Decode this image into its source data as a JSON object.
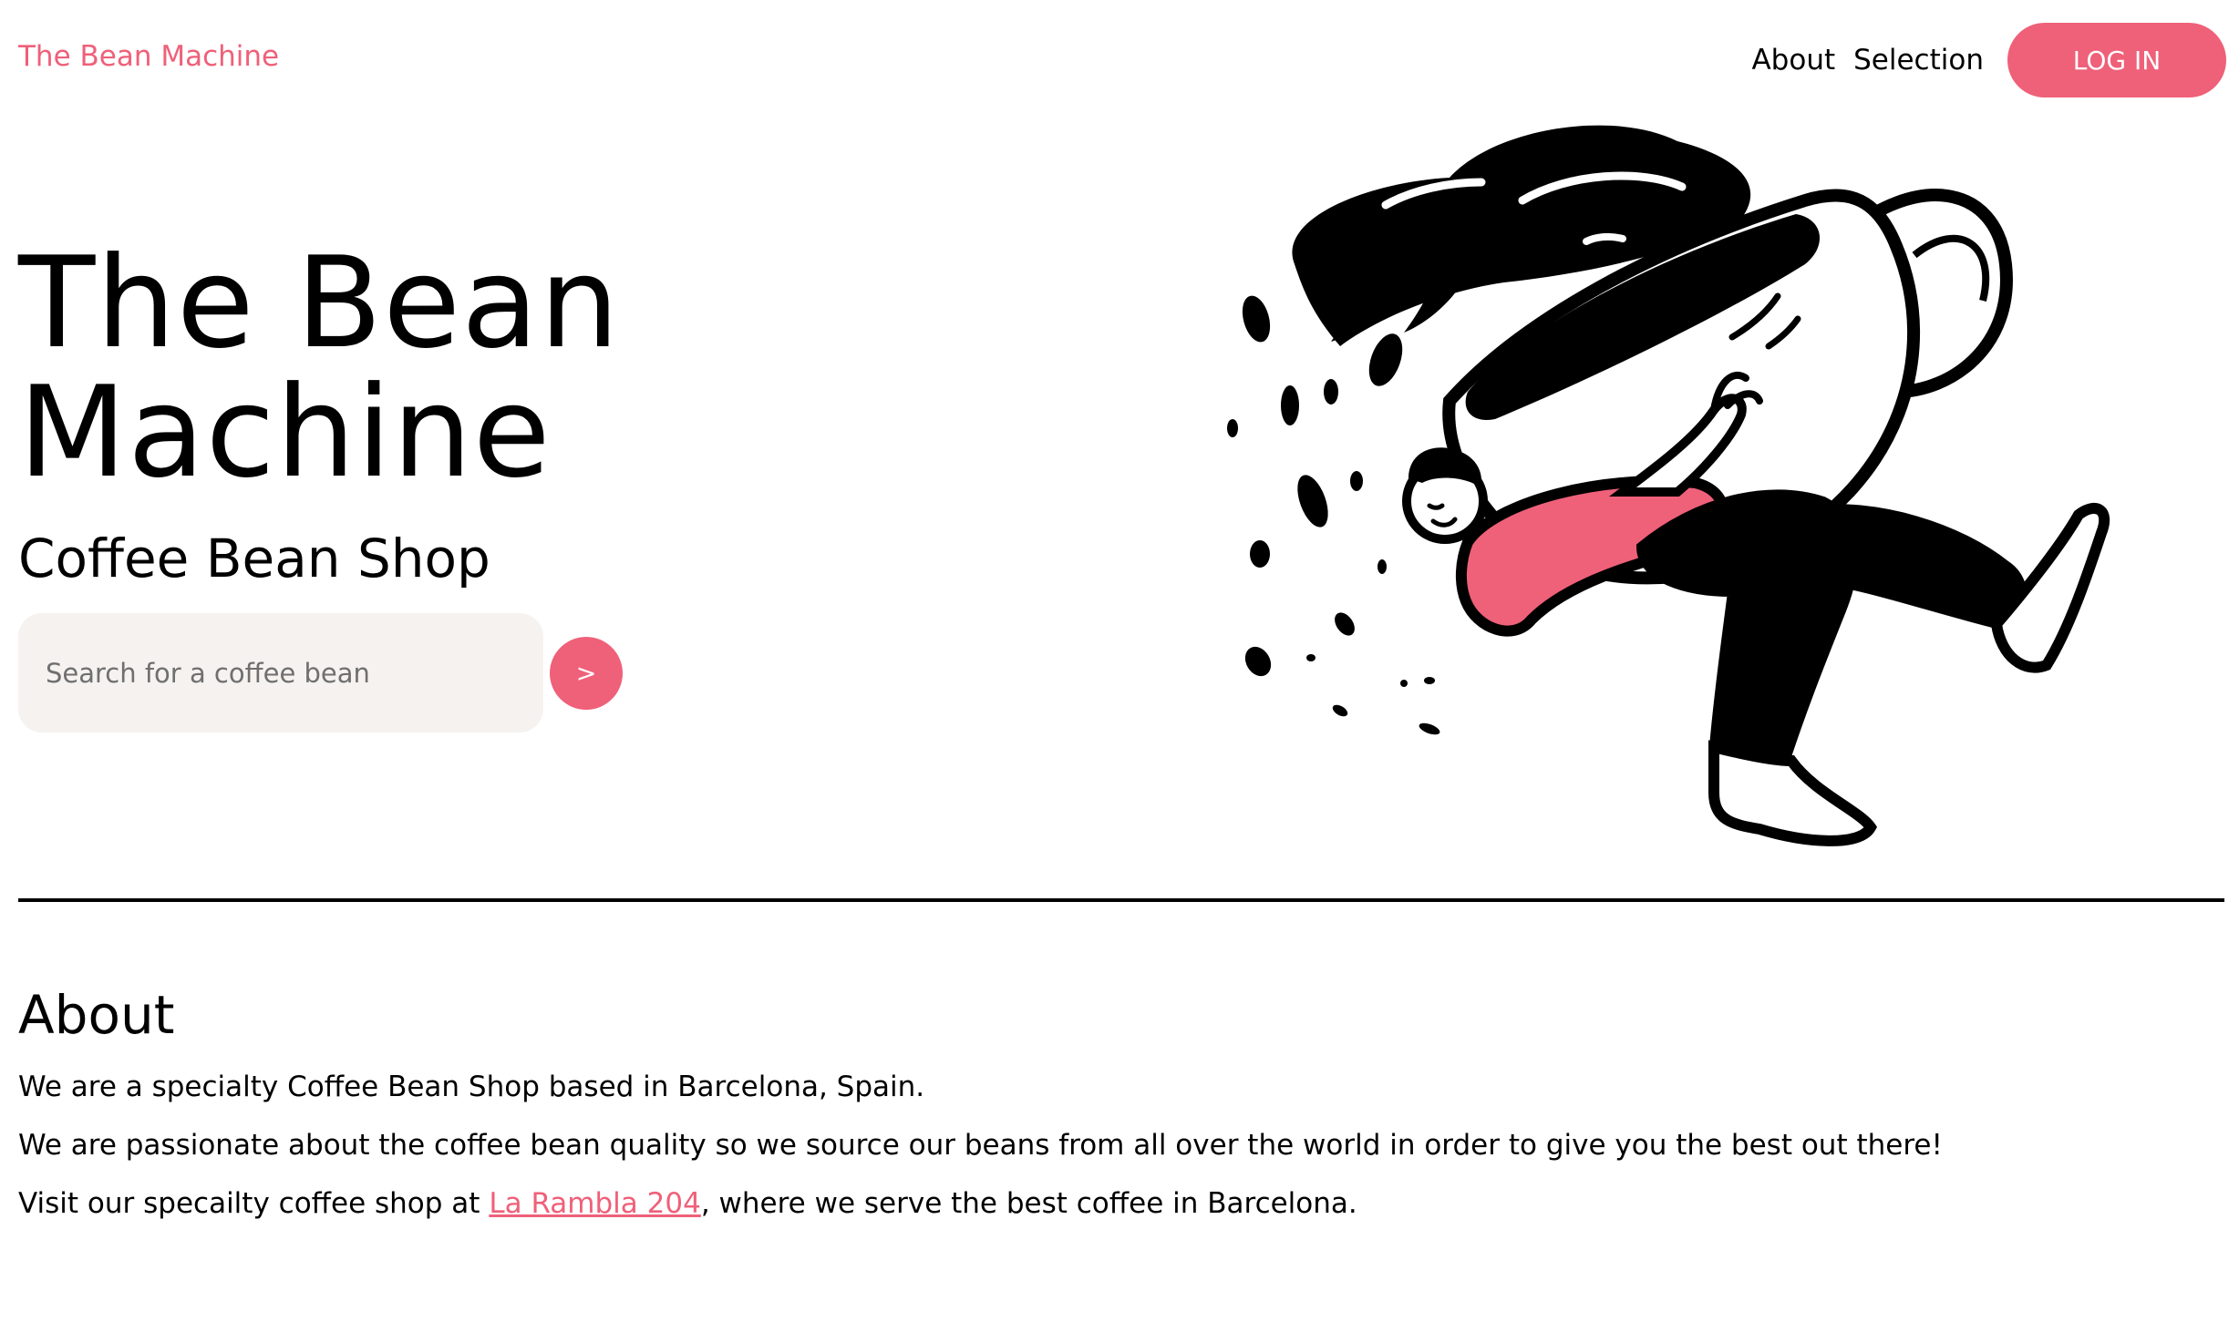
{
  "header": {
    "brand": "The Bean Machine",
    "nav": {
      "about": "About",
      "selection": "Selection"
    },
    "login_label": "LOG IN"
  },
  "hero": {
    "title_line1": "The Bean",
    "title_line2": "Machine",
    "subtitle": "Coffee Bean Shop",
    "search": {
      "placeholder": "Search for a coffee bean",
      "value": "",
      "button_label": ">"
    },
    "illustration": "coffee-cup-runner-illustration"
  },
  "about": {
    "heading": "About",
    "p1": "We are a specialty Coffee Bean Shop based in Barcelona, Spain.",
    "p2": "We are passionate about the coffee bean quality so we source our beans from all over the world in order to give you the best out there!",
    "p3_before": "Visit our specailty coffee shop at ",
    "p3_link": "La Rambla 204",
    "p3_after": ", where we serve the best coffee in Barcelona."
  },
  "colors": {
    "accent": "#ef6079",
    "search_bg": "#f5f2ef",
    "text": "#000000"
  }
}
